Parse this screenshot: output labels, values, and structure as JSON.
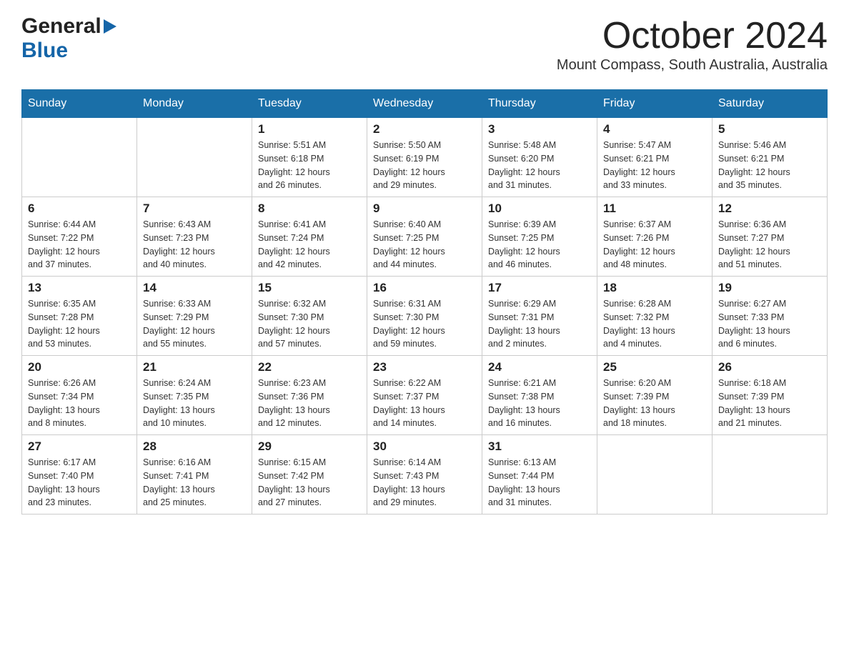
{
  "header": {
    "logo_general": "General",
    "logo_blue": "Blue",
    "month_title": "October 2024",
    "location": "Mount Compass, South Australia, Australia"
  },
  "weekdays": [
    "Sunday",
    "Monday",
    "Tuesday",
    "Wednesday",
    "Thursday",
    "Friday",
    "Saturday"
  ],
  "weeks": [
    [
      {
        "day": "",
        "info": ""
      },
      {
        "day": "",
        "info": ""
      },
      {
        "day": "1",
        "info": "Sunrise: 5:51 AM\nSunset: 6:18 PM\nDaylight: 12 hours\nand 26 minutes."
      },
      {
        "day": "2",
        "info": "Sunrise: 5:50 AM\nSunset: 6:19 PM\nDaylight: 12 hours\nand 29 minutes."
      },
      {
        "day": "3",
        "info": "Sunrise: 5:48 AM\nSunset: 6:20 PM\nDaylight: 12 hours\nand 31 minutes."
      },
      {
        "day": "4",
        "info": "Sunrise: 5:47 AM\nSunset: 6:21 PM\nDaylight: 12 hours\nand 33 minutes."
      },
      {
        "day": "5",
        "info": "Sunrise: 5:46 AM\nSunset: 6:21 PM\nDaylight: 12 hours\nand 35 minutes."
      }
    ],
    [
      {
        "day": "6",
        "info": "Sunrise: 6:44 AM\nSunset: 7:22 PM\nDaylight: 12 hours\nand 37 minutes."
      },
      {
        "day": "7",
        "info": "Sunrise: 6:43 AM\nSunset: 7:23 PM\nDaylight: 12 hours\nand 40 minutes."
      },
      {
        "day": "8",
        "info": "Sunrise: 6:41 AM\nSunset: 7:24 PM\nDaylight: 12 hours\nand 42 minutes."
      },
      {
        "day": "9",
        "info": "Sunrise: 6:40 AM\nSunset: 7:25 PM\nDaylight: 12 hours\nand 44 minutes."
      },
      {
        "day": "10",
        "info": "Sunrise: 6:39 AM\nSunset: 7:25 PM\nDaylight: 12 hours\nand 46 minutes."
      },
      {
        "day": "11",
        "info": "Sunrise: 6:37 AM\nSunset: 7:26 PM\nDaylight: 12 hours\nand 48 minutes."
      },
      {
        "day": "12",
        "info": "Sunrise: 6:36 AM\nSunset: 7:27 PM\nDaylight: 12 hours\nand 51 minutes."
      }
    ],
    [
      {
        "day": "13",
        "info": "Sunrise: 6:35 AM\nSunset: 7:28 PM\nDaylight: 12 hours\nand 53 minutes."
      },
      {
        "day": "14",
        "info": "Sunrise: 6:33 AM\nSunset: 7:29 PM\nDaylight: 12 hours\nand 55 minutes."
      },
      {
        "day": "15",
        "info": "Sunrise: 6:32 AM\nSunset: 7:30 PM\nDaylight: 12 hours\nand 57 minutes."
      },
      {
        "day": "16",
        "info": "Sunrise: 6:31 AM\nSunset: 7:30 PM\nDaylight: 12 hours\nand 59 minutes."
      },
      {
        "day": "17",
        "info": "Sunrise: 6:29 AM\nSunset: 7:31 PM\nDaylight: 13 hours\nand 2 minutes."
      },
      {
        "day": "18",
        "info": "Sunrise: 6:28 AM\nSunset: 7:32 PM\nDaylight: 13 hours\nand 4 minutes."
      },
      {
        "day": "19",
        "info": "Sunrise: 6:27 AM\nSunset: 7:33 PM\nDaylight: 13 hours\nand 6 minutes."
      }
    ],
    [
      {
        "day": "20",
        "info": "Sunrise: 6:26 AM\nSunset: 7:34 PM\nDaylight: 13 hours\nand 8 minutes."
      },
      {
        "day": "21",
        "info": "Sunrise: 6:24 AM\nSunset: 7:35 PM\nDaylight: 13 hours\nand 10 minutes."
      },
      {
        "day": "22",
        "info": "Sunrise: 6:23 AM\nSunset: 7:36 PM\nDaylight: 13 hours\nand 12 minutes."
      },
      {
        "day": "23",
        "info": "Sunrise: 6:22 AM\nSunset: 7:37 PM\nDaylight: 13 hours\nand 14 minutes."
      },
      {
        "day": "24",
        "info": "Sunrise: 6:21 AM\nSunset: 7:38 PM\nDaylight: 13 hours\nand 16 minutes."
      },
      {
        "day": "25",
        "info": "Sunrise: 6:20 AM\nSunset: 7:39 PM\nDaylight: 13 hours\nand 18 minutes."
      },
      {
        "day": "26",
        "info": "Sunrise: 6:18 AM\nSunset: 7:39 PM\nDaylight: 13 hours\nand 21 minutes."
      }
    ],
    [
      {
        "day": "27",
        "info": "Sunrise: 6:17 AM\nSunset: 7:40 PM\nDaylight: 13 hours\nand 23 minutes."
      },
      {
        "day": "28",
        "info": "Sunrise: 6:16 AM\nSunset: 7:41 PM\nDaylight: 13 hours\nand 25 minutes."
      },
      {
        "day": "29",
        "info": "Sunrise: 6:15 AM\nSunset: 7:42 PM\nDaylight: 13 hours\nand 27 minutes."
      },
      {
        "day": "30",
        "info": "Sunrise: 6:14 AM\nSunset: 7:43 PM\nDaylight: 13 hours\nand 29 minutes."
      },
      {
        "day": "31",
        "info": "Sunrise: 6:13 AM\nSunset: 7:44 PM\nDaylight: 13 hours\nand 31 minutes."
      },
      {
        "day": "",
        "info": ""
      },
      {
        "day": "",
        "info": ""
      }
    ]
  ]
}
